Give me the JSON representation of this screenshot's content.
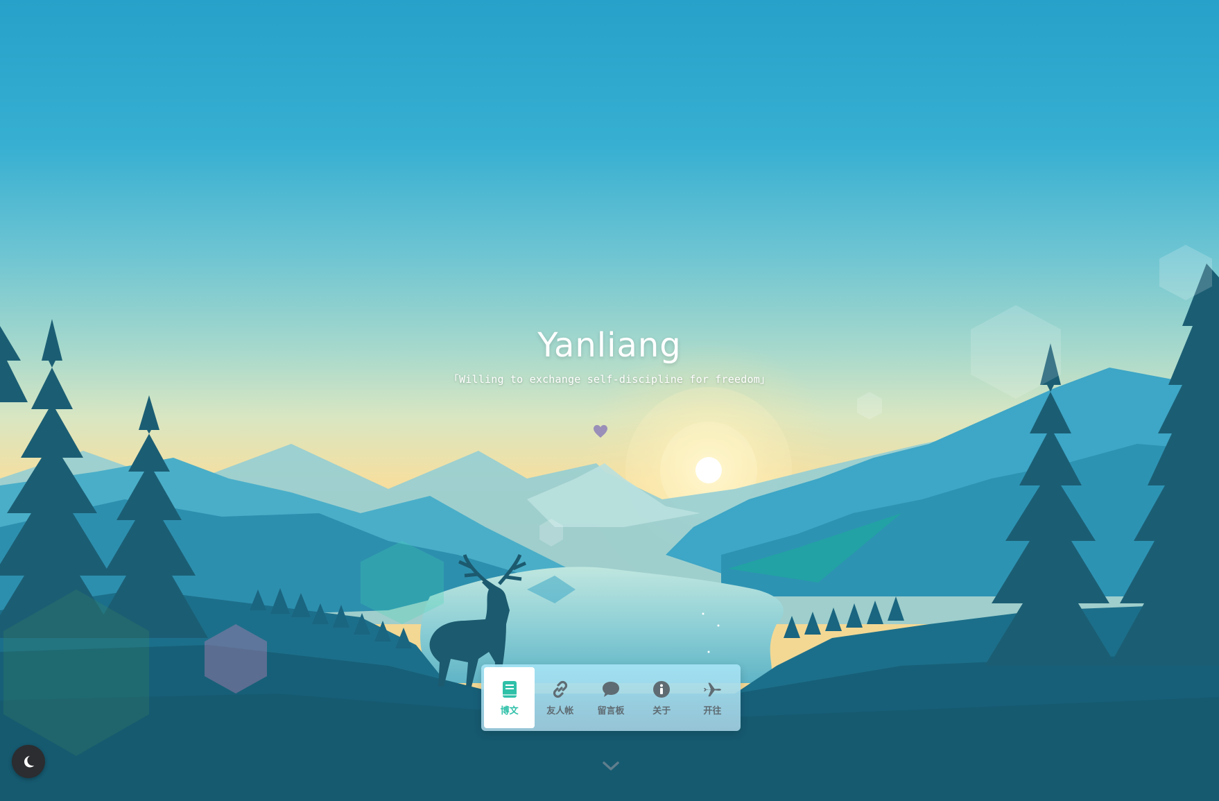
{
  "hero": {
    "title": "Yanliang",
    "subtitle": "「Willing to exchange self-discipline for freedom」"
  },
  "nav": {
    "items": [
      {
        "label": "博文",
        "icon": "book-icon",
        "active": true
      },
      {
        "label": "友人帐",
        "icon": "link-icon",
        "active": false
      },
      {
        "label": "留言板",
        "icon": "comment-icon",
        "active": false
      },
      {
        "label": "关于",
        "icon": "info-icon",
        "active": false
      },
      {
        "label": "开往",
        "icon": "plane-icon",
        "active": false
      }
    ]
  },
  "icons": {
    "heart": "heart-icon",
    "scroll_down": "chevron-down-icon",
    "theme_toggle": "moon-icon"
  },
  "colors": {
    "accent": "#2fc0a8",
    "nav_text": "#5f6b72",
    "toggle_bg": "#2b2d30",
    "heart": "#9a8fb8"
  }
}
